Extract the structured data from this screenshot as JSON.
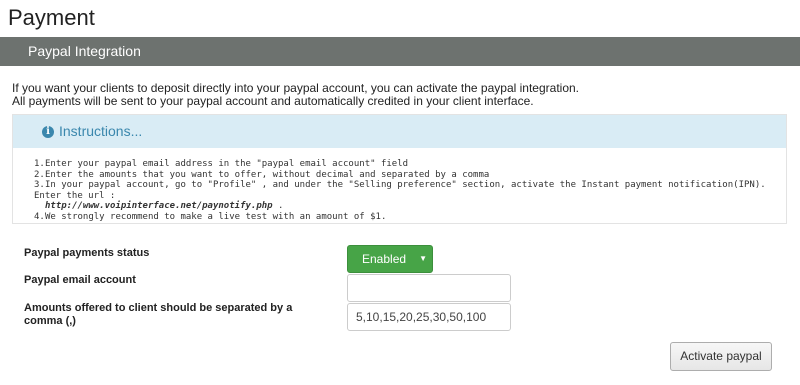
{
  "page": {
    "title": "Payment"
  },
  "panel": {
    "title": "Paypal Integration"
  },
  "intro": {
    "line1": "If you want your clients to deposit directly into your paypal account, you can activate the paypal integration.",
    "line2": "All payments will be sent to your paypal account and automatically credited in your client interface."
  },
  "instructions": {
    "icon": "info-icon",
    "title": "Instructions...",
    "items": [
      {
        "num": "1.",
        "text": "Enter your paypal email address in the \"paypal email account\" field"
      },
      {
        "num": "2.",
        "text": "Enter the amounts that you want to offer, without decimal and separated by a comma"
      },
      {
        "num": "3.",
        "text": "In your paypal account, go to \"Profile\" , and under the \"Selling preference\" section, activate the Instant payment notification(IPN). Enter the url :"
      },
      {
        "num": "",
        "url": "http://www.voipinterface.net/paynotify.php",
        "suffix": " ."
      },
      {
        "num": "4.",
        "text": "We strongly recommend to make a live test with an amount of $1."
      }
    ]
  },
  "form": {
    "status_label": "Paypal payments status",
    "status_value": "Enabled",
    "email_label": "Paypal email account",
    "email_value": "",
    "amounts_label_line1": "Amounts offered to client should be separated by a",
    "amounts_label_line2": "comma (,)",
    "amounts_value": "5,10,15,20,25,30,50,100",
    "activate_label": "Activate paypal"
  },
  "colors": {
    "header_bg": "#6d726f",
    "info_bg": "#d9ecf5",
    "info_text": "#3a87ad",
    "success": "#47a447"
  }
}
